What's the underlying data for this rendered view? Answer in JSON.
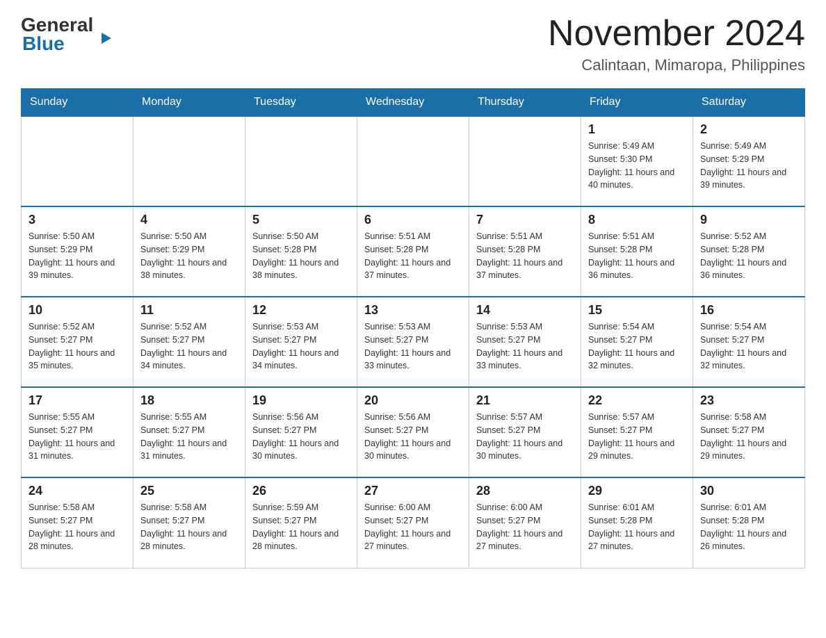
{
  "logo": {
    "part1": "General",
    "part2": "Blue"
  },
  "header": {
    "month": "November 2024",
    "location": "Calintaan, Mimaropa, Philippines"
  },
  "weekdays": [
    "Sunday",
    "Monday",
    "Tuesday",
    "Wednesday",
    "Thursday",
    "Friday",
    "Saturday"
  ],
  "weeks": [
    [
      {
        "day": "",
        "sunrise": "",
        "sunset": "",
        "daylight": ""
      },
      {
        "day": "",
        "sunrise": "",
        "sunset": "",
        "daylight": ""
      },
      {
        "day": "",
        "sunrise": "",
        "sunset": "",
        "daylight": ""
      },
      {
        "day": "",
        "sunrise": "",
        "sunset": "",
        "daylight": ""
      },
      {
        "day": "",
        "sunrise": "",
        "sunset": "",
        "daylight": ""
      },
      {
        "day": "1",
        "sunrise": "Sunrise: 5:49 AM",
        "sunset": "Sunset: 5:30 PM",
        "daylight": "Daylight: 11 hours and 40 minutes."
      },
      {
        "day": "2",
        "sunrise": "Sunrise: 5:49 AM",
        "sunset": "Sunset: 5:29 PM",
        "daylight": "Daylight: 11 hours and 39 minutes."
      }
    ],
    [
      {
        "day": "3",
        "sunrise": "Sunrise: 5:50 AM",
        "sunset": "Sunset: 5:29 PM",
        "daylight": "Daylight: 11 hours and 39 minutes."
      },
      {
        "day": "4",
        "sunrise": "Sunrise: 5:50 AM",
        "sunset": "Sunset: 5:29 PM",
        "daylight": "Daylight: 11 hours and 38 minutes."
      },
      {
        "day": "5",
        "sunrise": "Sunrise: 5:50 AM",
        "sunset": "Sunset: 5:28 PM",
        "daylight": "Daylight: 11 hours and 38 minutes."
      },
      {
        "day": "6",
        "sunrise": "Sunrise: 5:51 AM",
        "sunset": "Sunset: 5:28 PM",
        "daylight": "Daylight: 11 hours and 37 minutes."
      },
      {
        "day": "7",
        "sunrise": "Sunrise: 5:51 AM",
        "sunset": "Sunset: 5:28 PM",
        "daylight": "Daylight: 11 hours and 37 minutes."
      },
      {
        "day": "8",
        "sunrise": "Sunrise: 5:51 AM",
        "sunset": "Sunset: 5:28 PM",
        "daylight": "Daylight: 11 hours and 36 minutes."
      },
      {
        "day": "9",
        "sunrise": "Sunrise: 5:52 AM",
        "sunset": "Sunset: 5:28 PM",
        "daylight": "Daylight: 11 hours and 36 minutes."
      }
    ],
    [
      {
        "day": "10",
        "sunrise": "Sunrise: 5:52 AM",
        "sunset": "Sunset: 5:27 PM",
        "daylight": "Daylight: 11 hours and 35 minutes."
      },
      {
        "day": "11",
        "sunrise": "Sunrise: 5:52 AM",
        "sunset": "Sunset: 5:27 PM",
        "daylight": "Daylight: 11 hours and 34 minutes."
      },
      {
        "day": "12",
        "sunrise": "Sunrise: 5:53 AM",
        "sunset": "Sunset: 5:27 PM",
        "daylight": "Daylight: 11 hours and 34 minutes."
      },
      {
        "day": "13",
        "sunrise": "Sunrise: 5:53 AM",
        "sunset": "Sunset: 5:27 PM",
        "daylight": "Daylight: 11 hours and 33 minutes."
      },
      {
        "day": "14",
        "sunrise": "Sunrise: 5:53 AM",
        "sunset": "Sunset: 5:27 PM",
        "daylight": "Daylight: 11 hours and 33 minutes."
      },
      {
        "day": "15",
        "sunrise": "Sunrise: 5:54 AM",
        "sunset": "Sunset: 5:27 PM",
        "daylight": "Daylight: 11 hours and 32 minutes."
      },
      {
        "day": "16",
        "sunrise": "Sunrise: 5:54 AM",
        "sunset": "Sunset: 5:27 PM",
        "daylight": "Daylight: 11 hours and 32 minutes."
      }
    ],
    [
      {
        "day": "17",
        "sunrise": "Sunrise: 5:55 AM",
        "sunset": "Sunset: 5:27 PM",
        "daylight": "Daylight: 11 hours and 31 minutes."
      },
      {
        "day": "18",
        "sunrise": "Sunrise: 5:55 AM",
        "sunset": "Sunset: 5:27 PM",
        "daylight": "Daylight: 11 hours and 31 minutes."
      },
      {
        "day": "19",
        "sunrise": "Sunrise: 5:56 AM",
        "sunset": "Sunset: 5:27 PM",
        "daylight": "Daylight: 11 hours and 30 minutes."
      },
      {
        "day": "20",
        "sunrise": "Sunrise: 5:56 AM",
        "sunset": "Sunset: 5:27 PM",
        "daylight": "Daylight: 11 hours and 30 minutes."
      },
      {
        "day": "21",
        "sunrise": "Sunrise: 5:57 AM",
        "sunset": "Sunset: 5:27 PM",
        "daylight": "Daylight: 11 hours and 30 minutes."
      },
      {
        "day": "22",
        "sunrise": "Sunrise: 5:57 AM",
        "sunset": "Sunset: 5:27 PM",
        "daylight": "Daylight: 11 hours and 29 minutes."
      },
      {
        "day": "23",
        "sunrise": "Sunrise: 5:58 AM",
        "sunset": "Sunset: 5:27 PM",
        "daylight": "Daylight: 11 hours and 29 minutes."
      }
    ],
    [
      {
        "day": "24",
        "sunrise": "Sunrise: 5:58 AM",
        "sunset": "Sunset: 5:27 PM",
        "daylight": "Daylight: 11 hours and 28 minutes."
      },
      {
        "day": "25",
        "sunrise": "Sunrise: 5:58 AM",
        "sunset": "Sunset: 5:27 PM",
        "daylight": "Daylight: 11 hours and 28 minutes."
      },
      {
        "day": "26",
        "sunrise": "Sunrise: 5:59 AM",
        "sunset": "Sunset: 5:27 PM",
        "daylight": "Daylight: 11 hours and 28 minutes."
      },
      {
        "day": "27",
        "sunrise": "Sunrise: 6:00 AM",
        "sunset": "Sunset: 5:27 PM",
        "daylight": "Daylight: 11 hours and 27 minutes."
      },
      {
        "day": "28",
        "sunrise": "Sunrise: 6:00 AM",
        "sunset": "Sunset: 5:27 PM",
        "daylight": "Daylight: 11 hours and 27 minutes."
      },
      {
        "day": "29",
        "sunrise": "Sunrise: 6:01 AM",
        "sunset": "Sunset: 5:28 PM",
        "daylight": "Daylight: 11 hours and 27 minutes."
      },
      {
        "day": "30",
        "sunrise": "Sunrise: 6:01 AM",
        "sunset": "Sunset: 5:28 PM",
        "daylight": "Daylight: 11 hours and 26 minutes."
      }
    ]
  ]
}
